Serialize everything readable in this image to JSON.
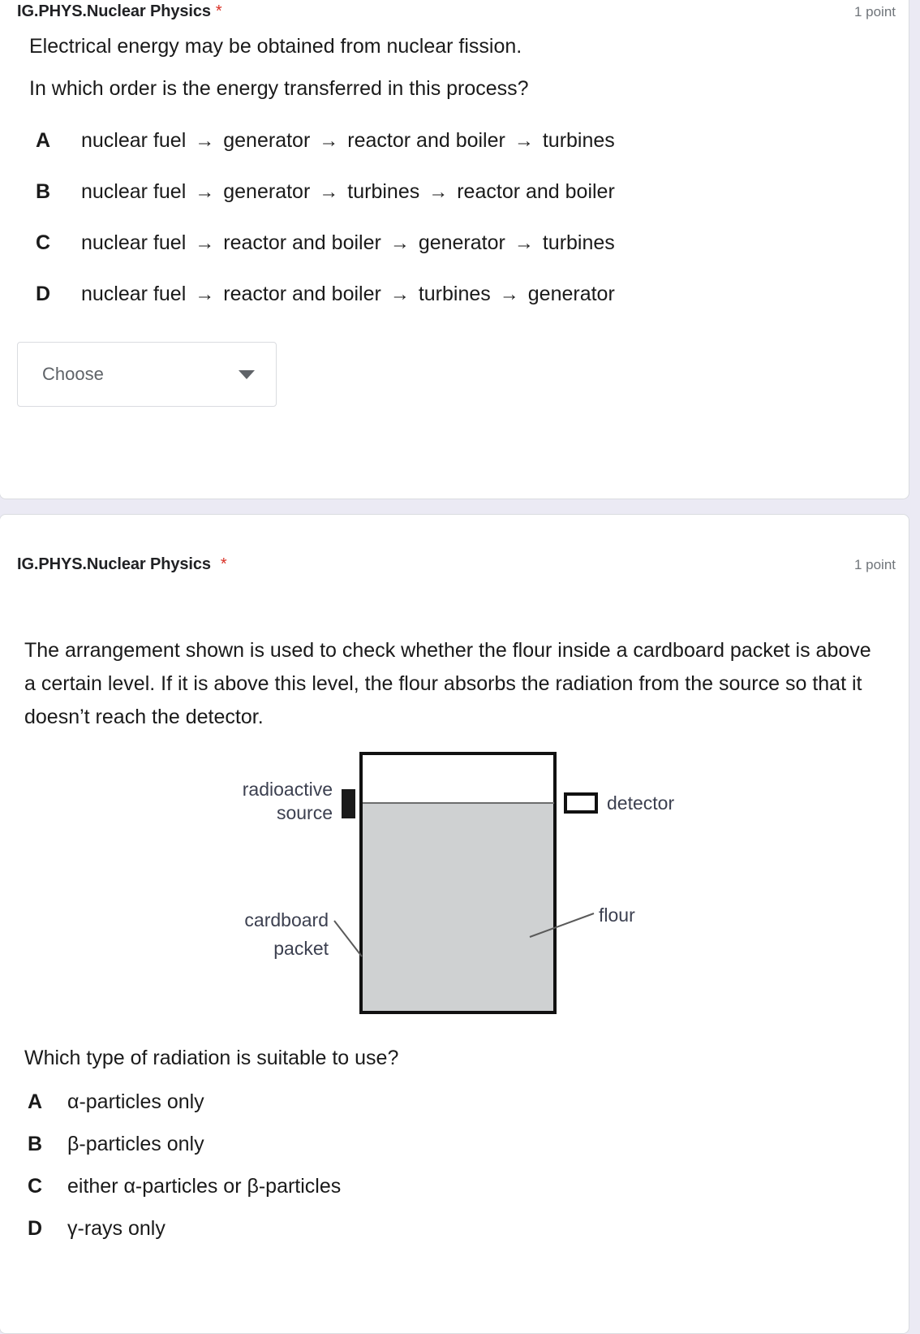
{
  "page": {
    "background_color": "#ebeaf4",
    "card_background": "#ffffff",
    "required_marker_color": "#d93025"
  },
  "questions": [
    {
      "title": "IG.PHYS.Nuclear Physics",
      "required_marker": "*",
      "points": "1 point",
      "stem_lines": [
        "Electrical energy may be obtained from nuclear fission.",
        "In which order is the energy transferred in this process?"
      ],
      "options": [
        {
          "letter": "A",
          "steps": [
            "nuclear fuel",
            "generator",
            "reactor and boiler",
            "turbines"
          ],
          "arrow": "→"
        },
        {
          "letter": "B",
          "steps": [
            "nuclear fuel",
            "generator",
            "turbines",
            "reactor and boiler"
          ],
          "arrow": "→"
        },
        {
          "letter": "C",
          "steps": [
            "nuclear fuel",
            "reactor and boiler",
            "generator",
            "turbines"
          ],
          "arrow": "→"
        },
        {
          "letter": "D",
          "steps": [
            "nuclear fuel",
            "reactor and boiler",
            "turbines",
            "generator"
          ],
          "arrow": "→"
        }
      ],
      "dropdown": {
        "placeholder": "Choose",
        "icon": "chevron-down-icon"
      }
    },
    {
      "title": "IG.PHYS.Nuclear Physics",
      "required_marker": "*",
      "points": "1 point",
      "paragraph": "The arrangement shown is used to check whether the flour inside a cardboard packet is above a certain level. If it is above this level, the flour absorbs the radiation from the source so that it doesn’t reach the detector.",
      "ask": "Which type of radiation is suitable to use?",
      "options": [
        {
          "letter": "A",
          "text": "α-particles only"
        },
        {
          "letter": "B",
          "text": "β-particles only"
        },
        {
          "letter": "C",
          "text": "either α-particles or β-particles"
        },
        {
          "letter": "D",
          "text": "γ-rays only"
        }
      ],
      "diagram": {
        "labels": {
          "source_line_1": "radioactive",
          "source_line_2": "source",
          "detector": "detector",
          "packet_line_1": "cardboard",
          "packet_line_2": "packet",
          "flour": "flour"
        },
        "colors": {
          "flour_fill": "#cfd1d2",
          "packet_outline": "#111111",
          "source_fill": "#1a1a1a",
          "leader_line": "#5a5a5a",
          "label_text": "#3c4050"
        }
      }
    }
  ]
}
